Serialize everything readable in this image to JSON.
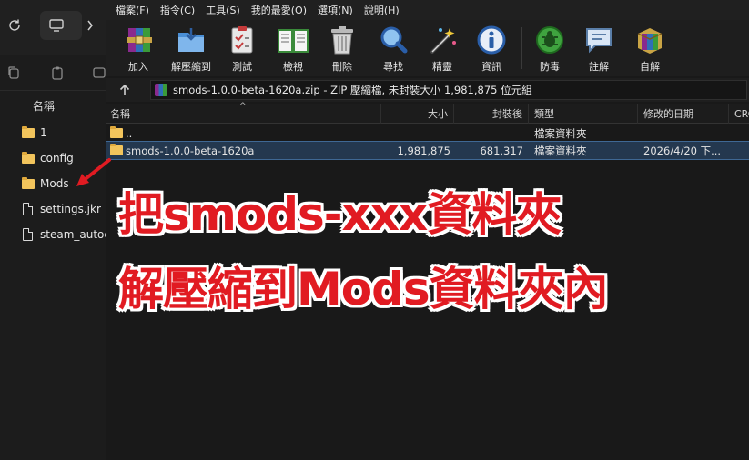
{
  "explorer": {
    "column_header": "名稱",
    "files": [
      {
        "name": "1",
        "kind": "folder"
      },
      {
        "name": "config",
        "kind": "folder"
      },
      {
        "name": "Mods",
        "kind": "folder"
      },
      {
        "name": "settings.jkr",
        "kind": "file"
      },
      {
        "name": "steam_autoc",
        "kind": "file"
      }
    ]
  },
  "winrar": {
    "menu": [
      "檔案(F)",
      "指令(C)",
      "工具(S)",
      "我的最愛(O)",
      "選項(N)",
      "說明(H)"
    ],
    "tools": [
      {
        "label": "加入",
        "icon": "add-archive-icon"
      },
      {
        "label": "解壓縮到",
        "icon": "extract-to-icon"
      },
      {
        "label": "測試",
        "icon": "test-icon"
      },
      {
        "label": "檢視",
        "icon": "view-icon"
      },
      {
        "label": "刪除",
        "icon": "delete-icon"
      },
      {
        "label": "尋找",
        "icon": "find-icon"
      },
      {
        "label": "精靈",
        "icon": "wizard-icon"
      },
      {
        "label": "資訊",
        "icon": "info-icon"
      },
      {
        "label": "防毒",
        "icon": "virus-scan-icon"
      },
      {
        "label": "註解",
        "icon": "comment-icon"
      },
      {
        "label": "自解",
        "icon": "sfx-icon"
      }
    ],
    "path_text": "smods-1.0.0-beta-1620a.zip - ZIP 壓縮檔, 未封裝大小 1,981,875 位元組",
    "columns": {
      "name": "名稱",
      "size": "大小",
      "packed": "封裝後",
      "type": "類型",
      "modified": "修改的日期",
      "crc": "CRC"
    },
    "rows": [
      {
        "name": "..",
        "size": "",
        "packed": "",
        "type": "檔案資料夾",
        "modified": "",
        "selected": false
      },
      {
        "name": "smods-1.0.0-beta-1620a",
        "size": "1,981,875",
        "packed": "681,317",
        "type": "檔案資料夾",
        "modified": "2026/4/20 下...",
        "selected": true
      }
    ]
  },
  "overlay": {
    "line1": "把smods-xxx資料夾",
    "line2": "解壓縮到Mods資料夾內",
    "color": "#e11b22"
  }
}
